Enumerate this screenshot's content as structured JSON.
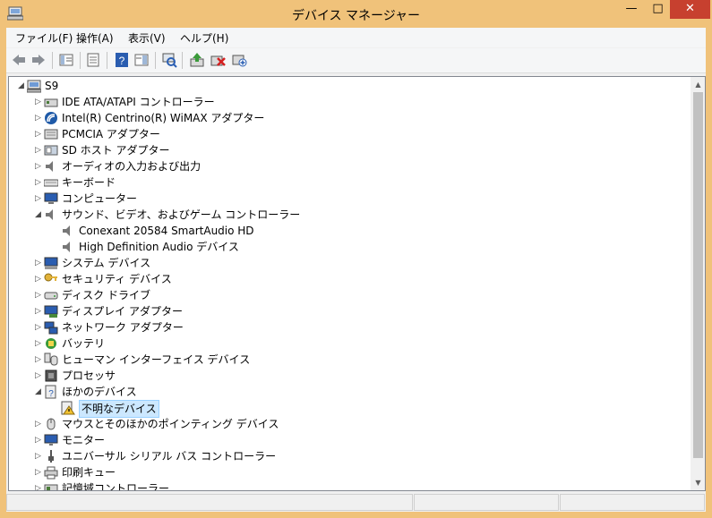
{
  "window": {
    "title": "デバイス マネージャー",
    "controls": {
      "minimize": "—",
      "maximize": "□",
      "close": "✕"
    }
  },
  "menu": [
    {
      "label": "ファイル(F)"
    },
    {
      "label": "操作(A)"
    },
    {
      "label": "表示(V)"
    },
    {
      "label": "ヘルプ(H)"
    }
  ],
  "toolbar": {
    "buttons": [
      {
        "icon": "back-arrow-icon"
      },
      {
        "icon": "forward-arrow-icon"
      },
      {
        "icon": "show-hide-console-tree-icon"
      },
      {
        "icon": "properties-icon"
      },
      {
        "icon": "help-icon"
      },
      {
        "icon": "action-pane-icon"
      },
      {
        "icon": "scan-hardware-changes-icon"
      },
      {
        "icon": "update-driver-icon"
      },
      {
        "icon": "uninstall-device-icon"
      },
      {
        "icon": "add-legacy-hardware-icon"
      }
    ]
  },
  "tree": {
    "root": {
      "label": "S9",
      "expanded": true
    },
    "items": [
      {
        "label": "IDE ATA/ATAPI コントローラー",
        "icon": "ide-controller-icon",
        "expanded": false
      },
      {
        "label": "Intel(R) Centrino(R) WiMAX アダプター",
        "icon": "wimax-icon",
        "expanded": false
      },
      {
        "label": "PCMCIA アダプター",
        "icon": "pcmcia-icon",
        "expanded": false
      },
      {
        "label": "SD ホスト アダプター",
        "icon": "sd-host-icon",
        "expanded": false
      },
      {
        "label": "オーディオの入力および出力",
        "icon": "audio-io-icon",
        "expanded": false
      },
      {
        "label": "キーボード",
        "icon": "keyboard-icon",
        "expanded": false
      },
      {
        "label": "コンピューター",
        "icon": "computer-icon",
        "expanded": false
      },
      {
        "label": "サウンド、ビデオ、およびゲーム コントローラー",
        "icon": "sound-icon",
        "expanded": true,
        "children": [
          {
            "label": "Conexant 20584 SmartAudio HD",
            "icon": "speaker-icon"
          },
          {
            "label": "High Definition Audio デバイス",
            "icon": "speaker-icon"
          }
        ]
      },
      {
        "label": "システム デバイス",
        "icon": "system-device-icon",
        "expanded": false
      },
      {
        "label": "セキュリティ デバイス",
        "icon": "security-key-icon",
        "expanded": false
      },
      {
        "label": "ディスク ドライブ",
        "icon": "disk-drive-icon",
        "expanded": false
      },
      {
        "label": "ディスプレイ アダプター",
        "icon": "display-adapter-icon",
        "expanded": false
      },
      {
        "label": "ネットワーク アダプター",
        "icon": "network-adapter-icon",
        "expanded": false
      },
      {
        "label": "バッテリ",
        "icon": "battery-icon",
        "expanded": false
      },
      {
        "label": "ヒューマン インターフェイス デバイス",
        "icon": "hid-icon",
        "expanded": false
      },
      {
        "label": "プロセッサ",
        "icon": "processor-icon",
        "expanded": false
      },
      {
        "label": "ほかのデバイス",
        "icon": "other-devices-icon",
        "expanded": true,
        "children": [
          {
            "label": "不明なデバイス",
            "icon": "unknown-device-warning-icon",
            "selected": true
          }
        ]
      },
      {
        "label": "マウスとそのほかのポインティング デバイス",
        "icon": "mouse-icon",
        "expanded": false
      },
      {
        "label": "モニター",
        "icon": "monitor-icon",
        "expanded": false
      },
      {
        "label": "ユニバーサル シリアル バス コントローラー",
        "icon": "usb-icon",
        "expanded": false
      },
      {
        "label": "印刷キュー",
        "icon": "printer-icon",
        "expanded": false
      },
      {
        "label": "記憶域コントローラー",
        "icon": "storage-controller-icon",
        "expanded": false
      }
    ]
  },
  "colors": {
    "accent": "#f0c27a",
    "close": "#c7402f",
    "selection": "#cce8ff"
  }
}
